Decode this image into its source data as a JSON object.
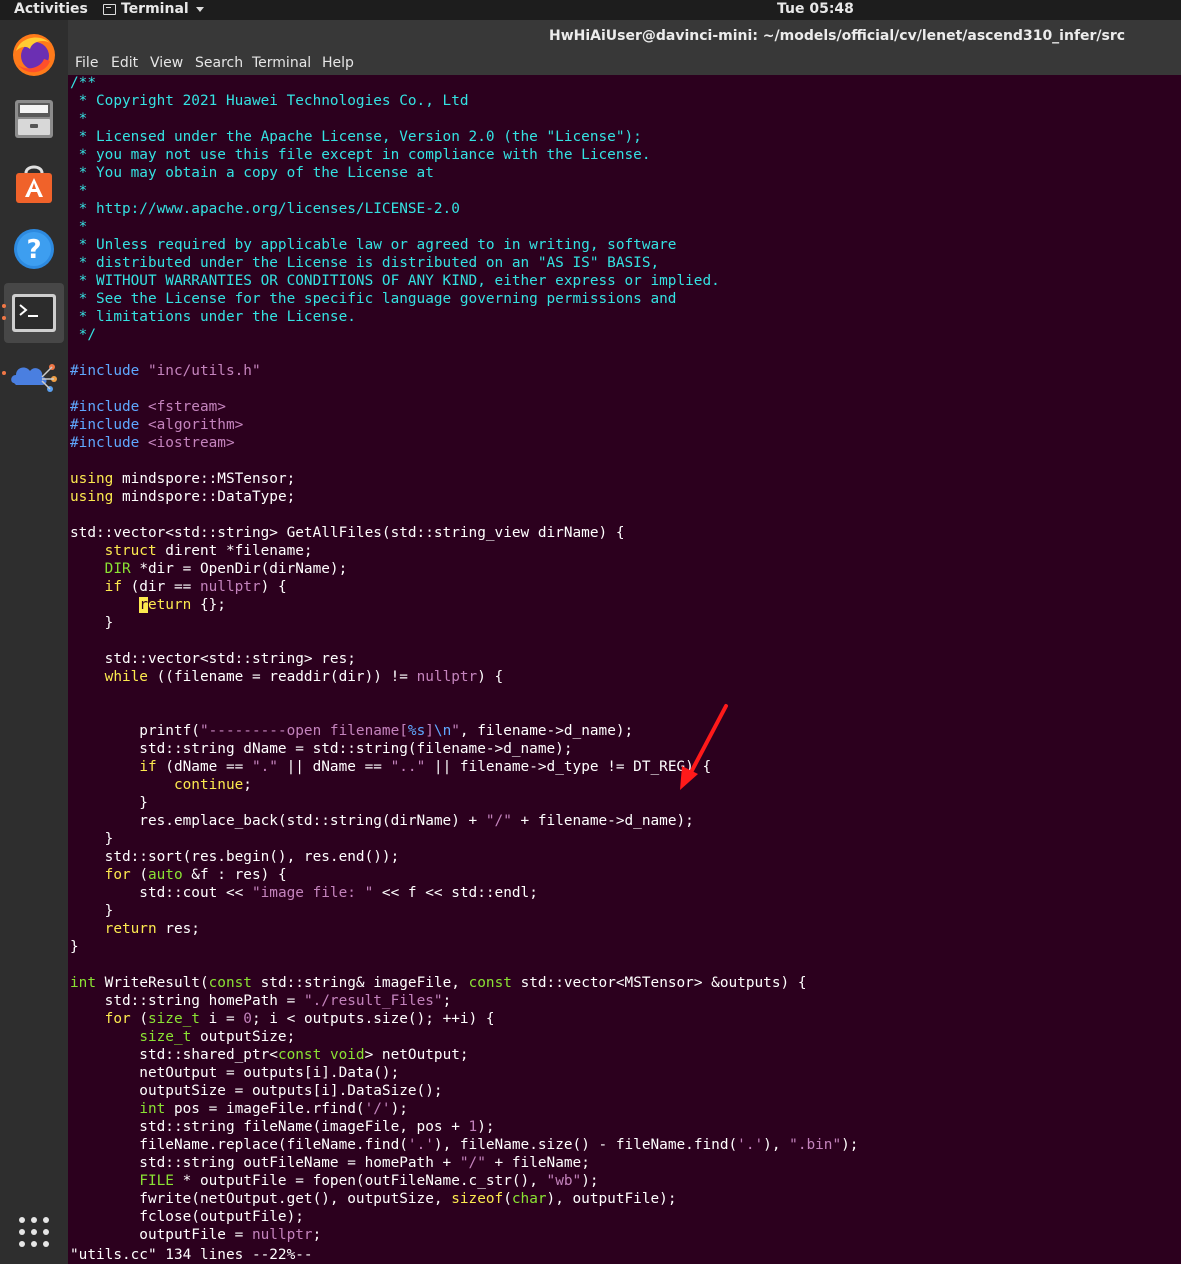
{
  "topbar": {
    "activities": "Activities",
    "app_name": "Terminal",
    "clock": "Tue 05:48"
  },
  "dock": {
    "items": [
      "firefox-icon",
      "files-icon",
      "software-icon",
      "help-icon",
      "terminal-icon",
      "app-icon",
      "show-apps-icon"
    ],
    "accent_color": "#f07746"
  },
  "window": {
    "title": "HwHiAiUser@davinci-mini: ~/models/official/cv/lenet/ascend310_infer/src",
    "menu": [
      "File",
      "Edit",
      "View",
      "Search",
      "Terminal",
      "Help"
    ]
  },
  "editor": {
    "colors": {
      "background": "#2c001e",
      "comment": "#34e2e2",
      "preproc": "#5fa8ff",
      "string": "#c483bd",
      "keyword": "#fce94f",
      "type": "#8ae234"
    },
    "lines": [
      [
        [
          "/**",
          "cm"
        ]
      ],
      [
        [
          " * Copyright 2021 Huawei Technologies Co., Ltd",
          "cm"
        ]
      ],
      [
        [
          " *",
          "cm"
        ]
      ],
      [
        [
          " * Licensed under the Apache License, Version 2.0 (the \"License\");",
          "cm"
        ]
      ],
      [
        [
          " * you may not use this file except in compliance with the License.",
          "cm"
        ]
      ],
      [
        [
          " * You may obtain a copy of the License at",
          "cm"
        ]
      ],
      [
        [
          " *",
          "cm"
        ]
      ],
      [
        [
          " * http://www.apache.org/licenses/LICENSE-2.0",
          "cm"
        ]
      ],
      [
        [
          " *",
          "cm"
        ]
      ],
      [
        [
          " * Unless required by applicable law or agreed to in writing, software",
          "cm"
        ]
      ],
      [
        [
          " * distributed under the License is distributed on an \"AS IS\" BASIS,",
          "cm"
        ]
      ],
      [
        [
          " * WITHOUT WARRANTIES OR CONDITIONS OF ANY KIND, either express or implied.",
          "cm"
        ]
      ],
      [
        [
          " * See the License for the specific language governing permissions and",
          "cm"
        ]
      ],
      [
        [
          " * limitations under the License.",
          "cm"
        ]
      ],
      [
        [
          " */",
          "cm"
        ]
      ],
      [],
      [
        [
          "#include ",
          "pp"
        ],
        [
          "\"inc/utils.h\"",
          "st"
        ]
      ],
      [],
      [
        [
          "#include ",
          "pp"
        ],
        [
          "<fstream>",
          "st"
        ]
      ],
      [
        [
          "#include ",
          "pp"
        ],
        [
          "<algorithm>",
          "st"
        ]
      ],
      [
        [
          "#include ",
          "pp"
        ],
        [
          "<iostream>",
          "st"
        ]
      ],
      [],
      [
        [
          "using",
          "kw"
        ],
        [
          " mindspore::MSTensor;",
          ""
        ]
      ],
      [
        [
          "using",
          "kw"
        ],
        [
          " mindspore::DataType;",
          ""
        ]
      ],
      [],
      [
        [
          "std::vector<std::string> GetAllFiles(std::string_view dirName) {",
          ""
        ]
      ],
      [
        [
          "    ",
          ""
        ],
        [
          "struct",
          "kw"
        ],
        [
          " dirent *filename;",
          ""
        ]
      ],
      [
        [
          "    ",
          ""
        ],
        [
          "DIR",
          "ty"
        ],
        [
          " *dir = OpenDir(dirName);",
          ""
        ]
      ],
      [
        [
          "    ",
          ""
        ],
        [
          "if",
          "kw"
        ],
        [
          " (dir == ",
          ""
        ],
        [
          "nullptr",
          "st"
        ],
        [
          ") {",
          ""
        ]
      ],
      [
        [
          "        ",
          ""
        ],
        [
          "r",
          "cursor"
        ],
        [
          "eturn",
          "kw"
        ],
        [
          " {};",
          ""
        ]
      ],
      [
        [
          "    }",
          ""
        ]
      ],
      [],
      [
        [
          "    std::vector<std::string> res;",
          ""
        ]
      ],
      [
        [
          "    ",
          ""
        ],
        [
          "while",
          "kw"
        ],
        [
          " ((filename = readdir(dir)) != ",
          ""
        ],
        [
          "nullptr",
          "st"
        ],
        [
          ") {",
          ""
        ]
      ],
      [],
      [],
      [
        [
          "        printf(",
          ""
        ],
        [
          "\"---------open filename[",
          "st"
        ],
        [
          "%s",
          "pp"
        ],
        [
          "]",
          "st"
        ],
        [
          "\\n",
          "pp"
        ],
        [
          "\"",
          "st"
        ],
        [
          ", filename->d_name);",
          ""
        ]
      ],
      [
        [
          "        std::string dName = std::string(filename->d_name);",
          ""
        ]
      ],
      [
        [
          "        ",
          ""
        ],
        [
          "if",
          "kw"
        ],
        [
          " (dName == ",
          ""
        ],
        [
          "\".\"",
          "st"
        ],
        [
          " || dName == ",
          ""
        ],
        [
          "\"..\"",
          "st"
        ],
        [
          " || filename->d_type != DT_REG) {",
          ""
        ]
      ],
      [
        [
          "            ",
          ""
        ],
        [
          "continue",
          "kw"
        ],
        [
          ";",
          ""
        ]
      ],
      [
        [
          "        }",
          ""
        ]
      ],
      [
        [
          "        res.emplace_back(std::string(dirName) + ",
          ""
        ],
        [
          "\"/\"",
          "st"
        ],
        [
          " + filename->d_name);",
          ""
        ]
      ],
      [
        [
          "    }",
          ""
        ]
      ],
      [
        [
          "    std::sort(res.begin(), res.end());",
          ""
        ]
      ],
      [
        [
          "    ",
          ""
        ],
        [
          "for",
          "kw"
        ],
        [
          " (",
          ""
        ],
        [
          "auto",
          "ty"
        ],
        [
          " &f : res) {",
          ""
        ]
      ],
      [
        [
          "        std::cout << ",
          ""
        ],
        [
          "\"image file: \"",
          "st"
        ],
        [
          " << f << std::endl;",
          ""
        ]
      ],
      [
        [
          "    }",
          ""
        ]
      ],
      [
        [
          "    ",
          ""
        ],
        [
          "return",
          "kw"
        ],
        [
          " res;",
          ""
        ]
      ],
      [
        [
          "}",
          ""
        ]
      ],
      [],
      [
        [
          "int",
          "ty"
        ],
        [
          " WriteResult(",
          ""
        ],
        [
          "const",
          "ty"
        ],
        [
          " std::string& imageFile, ",
          ""
        ],
        [
          "const",
          "ty"
        ],
        [
          " std::vector<MSTensor> &outputs) {",
          ""
        ]
      ],
      [
        [
          "    std::string homePath = ",
          ""
        ],
        [
          "\"./result_Files\"",
          "st"
        ],
        [
          ";",
          ""
        ]
      ],
      [
        [
          "    ",
          ""
        ],
        [
          "for",
          "kw"
        ],
        [
          " (",
          ""
        ],
        [
          "size_t",
          "ty"
        ],
        [
          " i = ",
          ""
        ],
        [
          "0",
          "st"
        ],
        [
          "; i < outputs.size(); ++i) {",
          ""
        ]
      ],
      [
        [
          "        ",
          ""
        ],
        [
          "size_t",
          "ty"
        ],
        [
          " outputSize;",
          ""
        ]
      ],
      [
        [
          "        std::shared_ptr<",
          ""
        ],
        [
          "const",
          "ty"
        ],
        [
          " ",
          ""
        ],
        [
          "void",
          "ty"
        ],
        [
          "> netOutput;",
          ""
        ]
      ],
      [
        [
          "        netOutput = outputs[i].Data();",
          ""
        ]
      ],
      [
        [
          "        outputSize = outputs[i].DataSize();",
          ""
        ]
      ],
      [
        [
          "        ",
          ""
        ],
        [
          "int",
          "ty"
        ],
        [
          " pos = imageFile.rfind(",
          ""
        ],
        [
          "'/'",
          "st"
        ],
        [
          ");",
          ""
        ]
      ],
      [
        [
          "        std::string fileName(imageFile, pos + ",
          ""
        ],
        [
          "1",
          "st"
        ],
        [
          ");",
          ""
        ]
      ],
      [
        [
          "        fileName.replace(fileName.find(",
          ""
        ],
        [
          "'.'",
          "st"
        ],
        [
          "), fileName.size() - fileName.find(",
          ""
        ],
        [
          "'.'",
          "st"
        ],
        [
          "), ",
          ""
        ],
        [
          "\".bin\"",
          "st"
        ],
        [
          ");",
          ""
        ]
      ],
      [
        [
          "        std::string outFileName = homePath + ",
          ""
        ],
        [
          "\"/\"",
          "st"
        ],
        [
          " + fileName;",
          ""
        ]
      ],
      [
        [
          "        ",
          ""
        ],
        [
          "FILE",
          "ty"
        ],
        [
          " * outputFile = fopen(outFileName.c_str(), ",
          ""
        ],
        [
          "\"wb\"",
          "st"
        ],
        [
          ");",
          ""
        ]
      ],
      [
        [
          "        fwrite(netOutput.get(), outputSize, ",
          ""
        ],
        [
          "sizeof",
          "kw"
        ],
        [
          "(",
          ""
        ],
        [
          "char",
          "ty"
        ],
        [
          "), outputFile);",
          ""
        ]
      ],
      [
        [
          "        fclose(outputFile);",
          ""
        ]
      ],
      [
        [
          "        outputFile = ",
          ""
        ],
        [
          "nullptr",
          "st"
        ],
        [
          ";",
          ""
        ]
      ]
    ],
    "status": "\"utils.cc\" 134 lines --22%--"
  }
}
